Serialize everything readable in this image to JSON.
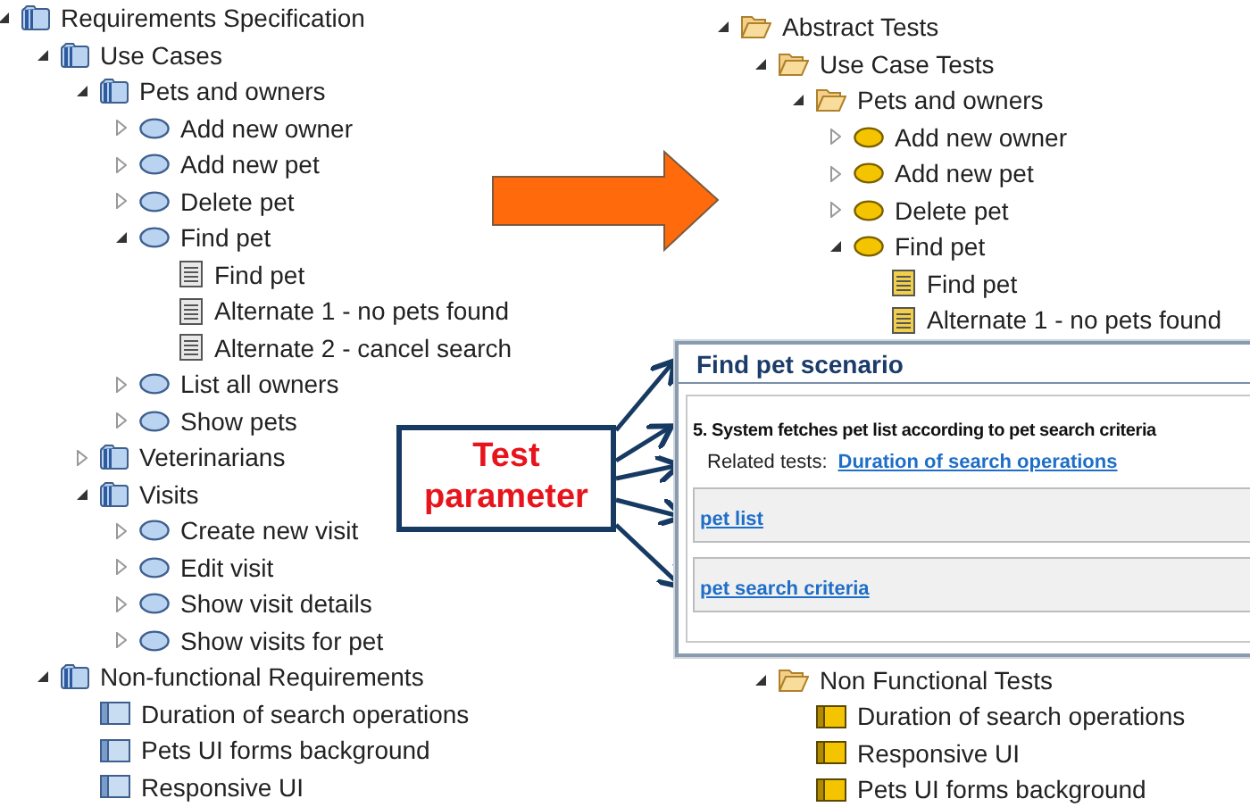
{
  "requirements_tree": [
    {
      "label": "Requirements Specification",
      "kind": "package",
      "expanded": true,
      "children": [
        {
          "label": "Use Cases",
          "kind": "package",
          "expanded": true,
          "children": [
            {
              "label": "Pets and owners",
              "kind": "package",
              "expanded": true,
              "children": [
                {
                  "label": "Add new owner",
                  "kind": "use_case",
                  "expanded": false
                },
                {
                  "label": "Add new pet",
                  "kind": "use_case",
                  "expanded": false
                },
                {
                  "label": "Delete pet",
                  "kind": "use_case",
                  "expanded": false
                },
                {
                  "label": "Find pet",
                  "kind": "use_case",
                  "expanded": true,
                  "children": [
                    {
                      "label": "Find pet",
                      "kind": "scenario"
                    },
                    {
                      "label": "Alternate 1 - no pets found",
                      "kind": "scenario"
                    },
                    {
                      "label": "Alternate 2 - cancel search",
                      "kind": "scenario"
                    }
                  ]
                },
                {
                  "label": "List all owners",
                  "kind": "use_case",
                  "expanded": false
                },
                {
                  "label": "Show pets",
                  "kind": "use_case",
                  "expanded": false
                }
              ]
            },
            {
              "label": "Veterinarians",
              "kind": "package",
              "expanded": false
            },
            {
              "label": "Visits",
              "kind": "package",
              "expanded": true,
              "children": [
                {
                  "label": "Create new visit",
                  "kind": "use_case",
                  "expanded": false
                },
                {
                  "label": "Edit visit",
                  "kind": "use_case",
                  "expanded": false
                },
                {
                  "label": "Show visit details",
                  "kind": "use_case",
                  "expanded": false
                },
                {
                  "label": "Show visits for pet",
                  "kind": "use_case",
                  "expanded": false
                }
              ]
            }
          ]
        },
        {
          "label": "Non-functional Requirements",
          "kind": "package",
          "expanded": true,
          "children": [
            {
              "label": "Duration of search operations",
              "kind": "requirement"
            },
            {
              "label": "Pets UI forms background",
              "kind": "requirement"
            },
            {
              "label": "Responsive UI",
              "kind": "requirement"
            }
          ]
        }
      ]
    }
  ],
  "test_tree": [
    {
      "label": "Abstract Tests",
      "kind": "folder",
      "expanded": true,
      "children": [
        {
          "label": "Use Case Tests",
          "kind": "folder",
          "expanded": true,
          "children": [
            {
              "label": "Pets and owners",
              "kind": "folder",
              "expanded": true,
              "children": [
                {
                  "label": "Add new owner",
                  "kind": "use_case",
                  "expanded": false
                },
                {
                  "label": "Add new pet",
                  "kind": "use_case",
                  "expanded": false
                },
                {
                  "label": "Delete pet",
                  "kind": "use_case",
                  "expanded": false
                },
                {
                  "label": "Find pet",
                  "kind": "use_case",
                  "expanded": true,
                  "children": [
                    {
                      "label": "Find pet",
                      "kind": "scenario"
                    },
                    {
                      "label": "Alternate 1 - no pets found",
                      "kind": "scenario"
                    }
                  ]
                }
              ]
            }
          ]
        },
        {
          "label": "Non Functional Tests",
          "kind": "folder",
          "expanded": true,
          "children": [
            {
              "label": "Duration of search operations",
              "kind": "requirement"
            },
            {
              "label": "Responsive UI",
              "kind": "requirement"
            },
            {
              "label": "Pets UI forms background",
              "kind": "requirement"
            }
          ]
        }
      ]
    }
  ],
  "scenario_panel": {
    "title": "Find pet scenario",
    "step": "5. System fetches pet list according to pet search criteria",
    "related_label": "Related tests:",
    "related_link": "Duration of search operations",
    "parameters": [
      "pet list",
      "pet search criteria"
    ]
  },
  "callout": {
    "text": "Test parameter"
  }
}
